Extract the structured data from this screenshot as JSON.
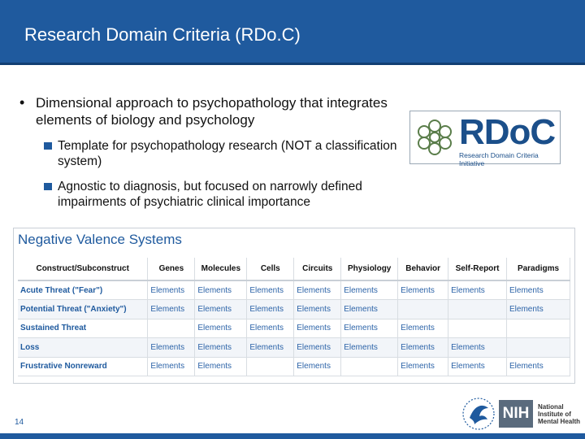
{
  "slide": {
    "title": "Research Domain Criteria (RDo.C)",
    "page_number": "14"
  },
  "bullets": {
    "main": "Dimensional approach to psychopathology that integrates elements of biology and psychology",
    "sub": [
      "Template for psychopathology research (NOT a classification system)",
      "Agnostic to diagnosis, but focused on narrowly defined impairments of psychiatric clinical importance"
    ]
  },
  "rdoc_logo": {
    "word": "RDoC",
    "subtitle": "Research Domain Criteria Initiative",
    "brand_color": "#1b4f8a"
  },
  "matrix": {
    "title": "Negative Valence Systems",
    "headers": [
      "Construct/Subconstruct",
      "Genes",
      "Molecules",
      "Cells",
      "Circuits",
      "Physiology",
      "Behavior",
      "Self-Report",
      "Paradigms"
    ],
    "rows": [
      [
        "Acute Threat (\"Fear\")",
        "Elements",
        "Elements",
        "Elements",
        "Elements",
        "Elements",
        "Elements",
        "Elements",
        "Elements"
      ],
      [
        "Potential Threat (\"Anxiety\")",
        "Elements",
        "Elements",
        "Elements",
        "Elements",
        "Elements",
        "",
        "",
        "Elements"
      ],
      [
        "Sustained Threat",
        "",
        "Elements",
        "Elements",
        "Elements",
        "Elements",
        "Elements",
        "",
        ""
      ],
      [
        "Loss",
        "Elements",
        "Elements",
        "Elements",
        "Elements",
        "Elements",
        "Elements",
        "Elements",
        ""
      ],
      [
        "Frustrative Nonreward",
        "Elements",
        "Elements",
        "",
        "Elements",
        "",
        "Elements",
        "Elements",
        "Elements"
      ]
    ]
  },
  "footer": {
    "nih_box": "NIH",
    "nih_text": "National Institute of Mental Health"
  },
  "colors": {
    "title_bar": "#1f5a9e",
    "link_text": "#2d64a8"
  }
}
